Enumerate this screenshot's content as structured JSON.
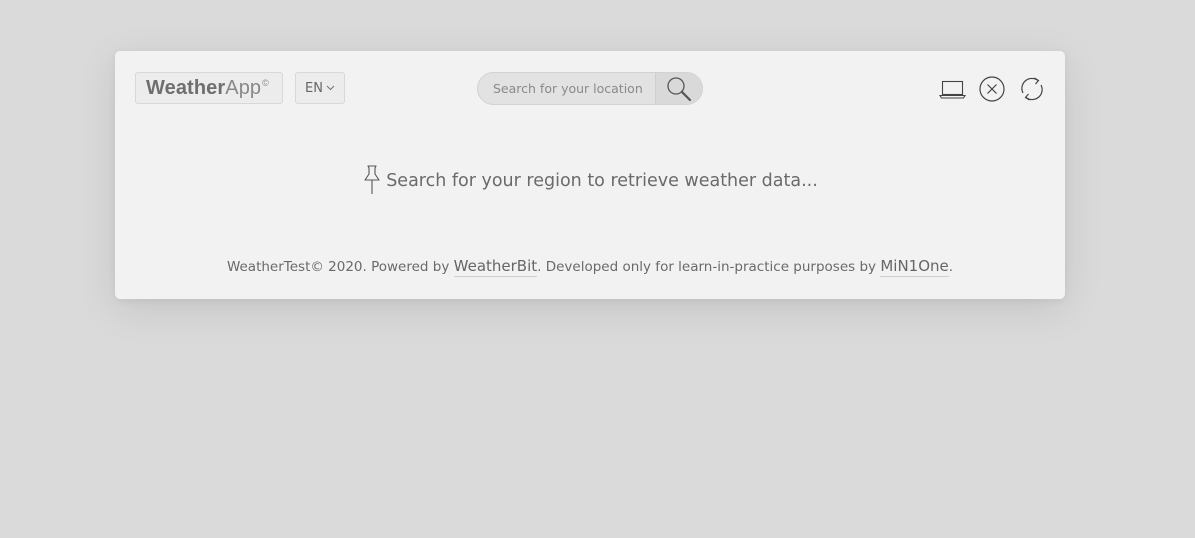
{
  "header": {
    "logo_bold": "Weather",
    "logo_light": "App",
    "logo_mark": "©",
    "language": "EN",
    "search": {
      "placeholder": "Search for your location",
      "value": ""
    },
    "icons": [
      "laptop-icon",
      "close-icon",
      "refresh-icon",
      "search-icon",
      "chevron-down-icon",
      "pushpin-icon"
    ]
  },
  "main": {
    "hint": "Search for your region to retrieve weather data..."
  },
  "footer": {
    "prefix": "WeatherTest© 2020. Powered by",
    "provider_link": "WeatherBit",
    "middle": ". Developed only for learn-in-practice purposes by",
    "author_link": "MiN1One",
    "suffix": "."
  },
  "colors": {
    "background": "#dadada",
    "card": "#f2f2f2",
    "text": "#666666"
  }
}
